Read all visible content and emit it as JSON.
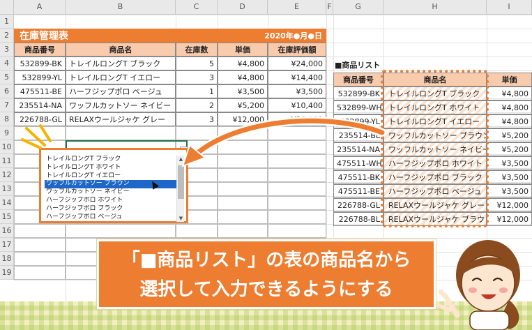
{
  "columns": {
    "A": "A",
    "B": "B",
    "C": "C",
    "D": "D",
    "E": "E",
    "F": "F",
    "G": "G",
    "H": "H",
    "I": "I"
  },
  "rows": [
    "1",
    "2",
    "3",
    "4",
    "5",
    "6",
    "7",
    "8",
    "9",
    "10",
    "11",
    "12",
    "13",
    "14",
    "15",
    "16",
    "17",
    "18",
    "19"
  ],
  "inventory": {
    "title": "在庫管理表",
    "date": "2020年●月●日",
    "headers": [
      "商品番号",
      "商品名",
      "在庫数",
      "単価",
      "在庫評価額"
    ],
    "rows": [
      {
        "code": "532899-BK",
        "name": "トレイルロングT ブラック",
        "qty": "5",
        "price": "¥4,800",
        "value": "¥24,000"
      },
      {
        "code": "532899-YL",
        "name": "トレイルロングT イエロー",
        "qty": "3",
        "price": "¥4,800",
        "value": "¥14,400"
      },
      {
        "code": "475511-BE",
        "name": "ハーフジップポロ ベージュ",
        "qty": "1",
        "price": "¥3,500",
        "value": "¥3,500"
      },
      {
        "code": "235514-NA",
        "name": "ワッフルカットソー ネイビー",
        "qty": "2",
        "price": "¥5,200",
        "value": "¥10,400"
      },
      {
        "code": "226788-GL",
        "name": "RELAXウールジャケ グレー",
        "qty": "3",
        "price": "¥12,000",
        "value": "¥36,000"
      }
    ]
  },
  "product_list": {
    "title": "■商品リスト",
    "headers": [
      "商品番号",
      "商品名",
      "単価"
    ],
    "rows": [
      {
        "code": "532899-BK",
        "name": "トレイルロングT ブラック",
        "price": "¥4,800"
      },
      {
        "code": "532899-WH",
        "name": "トレイルロングT ホワイト",
        "price": "¥4,800"
      },
      {
        "code": "532899-YL",
        "name": "トレイルロングT イエロー",
        "price": "¥4,800"
      },
      {
        "code": "235514-BL",
        "name": "ワッフルカットソー ブラウン",
        "price": "¥5,200"
      },
      {
        "code": "235514-NA",
        "name": "ワッフルカットソー ネイビー",
        "price": "¥5,200"
      },
      {
        "code": "475511-WH",
        "name": "ハーフジップポロ ホワイト",
        "price": "¥3,500"
      },
      {
        "code": "475511-BK",
        "name": "ハーフジップポロ ブラック",
        "price": "¥3,500"
      },
      {
        "code": "475511-BE",
        "name": "ハーフジップポロ ベージュ",
        "price": "¥3,500"
      },
      {
        "code": "226788-GL",
        "name": "RELAXウールジャケ グレー",
        "price": "¥12,000"
      },
      {
        "code": "226788-BL",
        "name": "RELAXウールジャケ ブラウン",
        "price": "¥12,000"
      }
    ]
  },
  "dropdown": {
    "options": [
      "トレイルロングT ブラック",
      "トレイルロングT ホワイト",
      "トレイルロングT イエロー",
      "ワッフルカットソー ブラウン",
      "ワッフルカットソー ネイビー",
      "ハーフジップポロ ホワイト",
      "ハーフジップポロ ブラック",
      "ハーフジップポロ ベージュ"
    ],
    "selected": "ワッフルカットソー ブラウン"
  },
  "banner": {
    "line1": "「■商品リスト」の表の商品名から",
    "line2": "選択して入力できるようにする"
  },
  "colors": {
    "accent": "#ed7d31",
    "header_fill": "#f8cbad",
    "highlight": "#1e67c8",
    "background": "#f3efc2"
  },
  "icons": [
    "mouse-cursor-icon",
    "dropdown-arrow-icon",
    "curved-arrow-icon",
    "sparkle-icon",
    "woman-character-icon"
  ]
}
